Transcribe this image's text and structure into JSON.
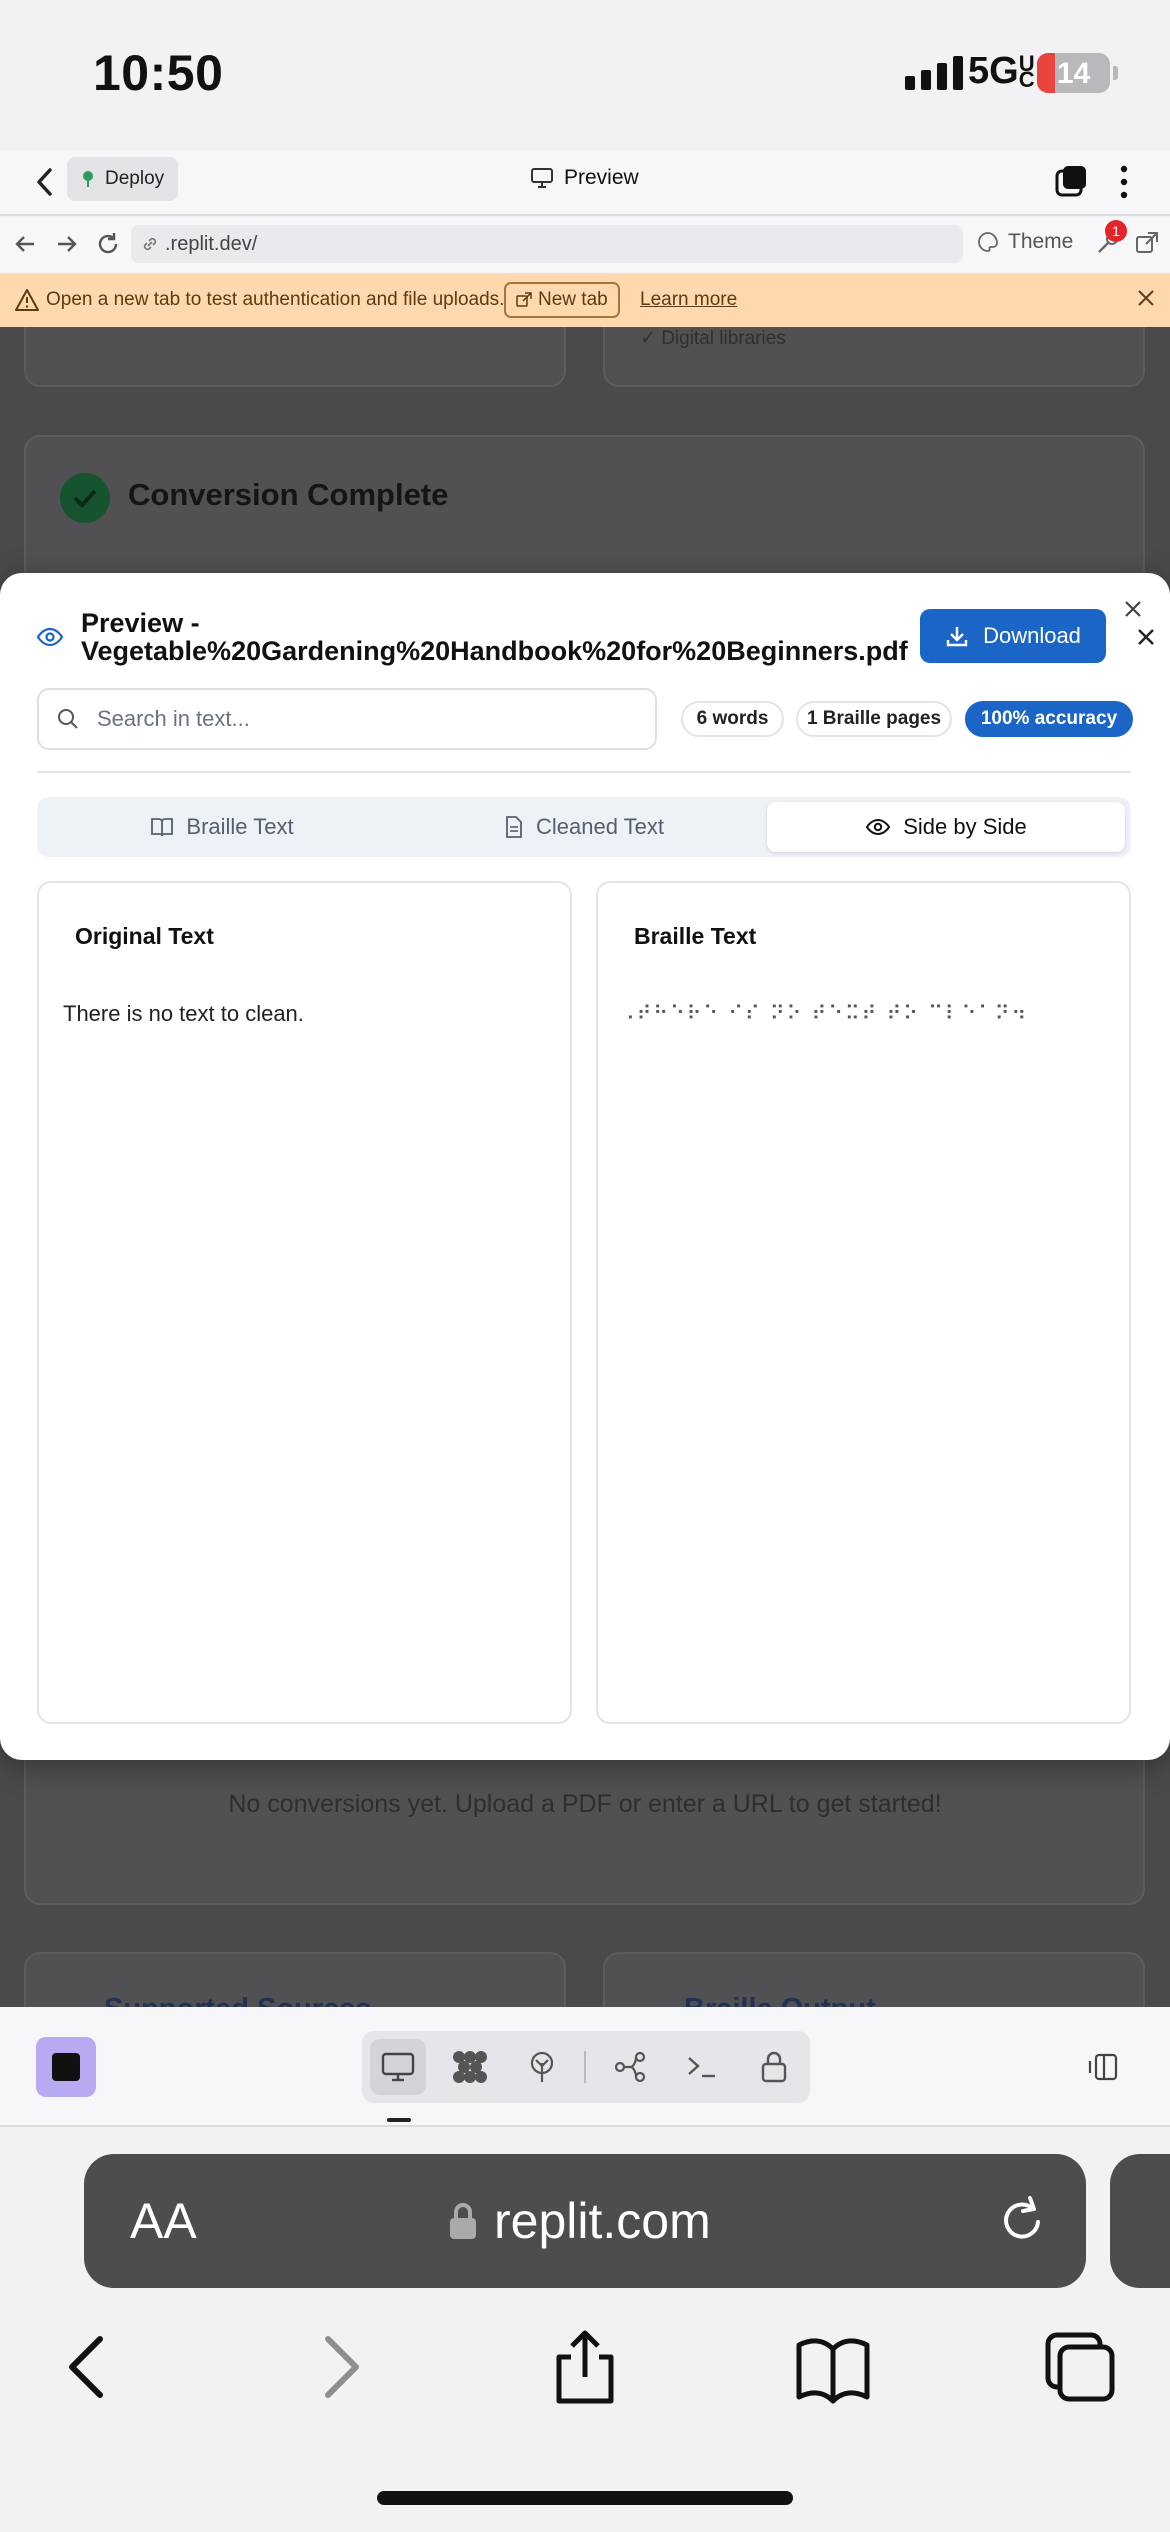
{
  "status_bar": {
    "time": "10:50",
    "network": "5GUC",
    "battery": "14",
    "battery_level": 0.14
  },
  "replit_bar": {
    "deploy_label": "Deploy",
    "preview_label": "Preview"
  },
  "url_bar": {
    "url": ".replit.dev/",
    "theme_label": "Theme",
    "devtools_badge": "1"
  },
  "notice": {
    "message": "Open a new tab to test authentication and file uploads.",
    "new_tab_label": "New tab",
    "learn_more_label": "Learn more"
  },
  "background": {
    "digital_libraries": "✓ Digital libraries",
    "conversion_title": "Conversion Complete",
    "empty_message": "No conversions yet. Upload a PDF or enter a URL to get started!",
    "supported_sources": "Supported Sources",
    "braille_output": "Braille Output"
  },
  "modal": {
    "title_prefix": "Preview -",
    "filename": "Vegetable%20Gardening%20Handbook%20for%20Beginners.pdf",
    "download_label": "Download",
    "search_placeholder": "Search in text...",
    "stats": {
      "words": "6 words",
      "pages": "1 Braille pages",
      "accuracy": "100% accuracy"
    },
    "tabs": [
      {
        "label": "Braille Text",
        "icon": "book-open-icon"
      },
      {
        "label": "Cleaned Text",
        "icon": "file-text-icon"
      },
      {
        "label": "Side by Side",
        "icon": "eye-icon",
        "active": true
      }
    ],
    "original": {
      "title": "Original Text",
      "text": "There is no text to clean."
    },
    "braille": {
      "title": "Braille Text",
      "text": "⠠⠞⠓⠑⠗⠑ ⠊⠎ ⠝⠕ ⠞⠑⠭⠞ ⠞⠕ ⠉⠇⠑⠁⠝⠲"
    }
  },
  "safari": {
    "aa_label": "AA",
    "domain": "replit.com"
  },
  "colors": {
    "accent": "#1a65c6",
    "notice_bg": "#ffd8ad",
    "stop_button": "#b9a9f3"
  }
}
